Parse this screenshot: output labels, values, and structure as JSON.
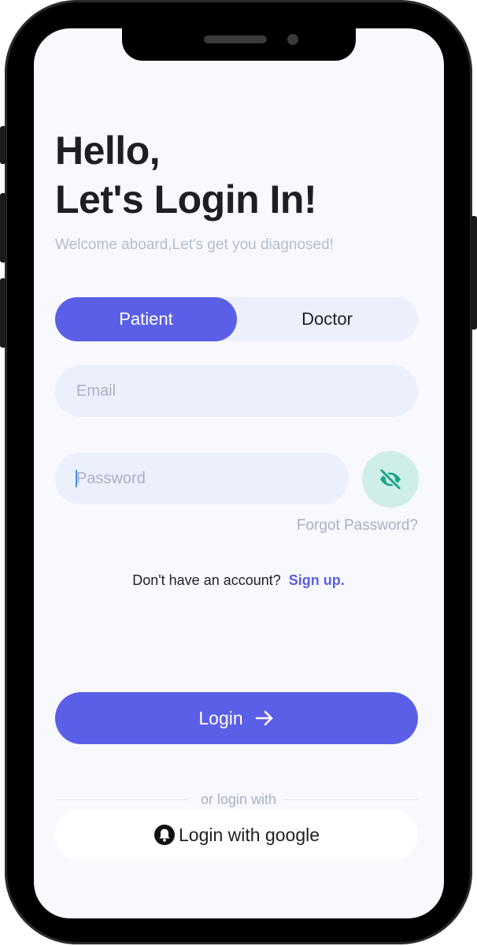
{
  "header": {
    "title_line1": "Hello,",
    "title_line2": "Let's Login In!",
    "subtitle": "Welcome aboard,Let's get you diagnosed!"
  },
  "role_toggle": {
    "selected": "Patient",
    "options": [
      "Patient",
      "Doctor"
    ]
  },
  "form": {
    "email_placeholder": "Email",
    "email_value": "",
    "password_placeholder": "Password",
    "password_value": "",
    "visibility_icon": "eye-off-icon",
    "forgot_password": "Forgot Password?"
  },
  "signup": {
    "prompt": "Don't have an account?",
    "link": "Sign up."
  },
  "login_button": {
    "label": "Login",
    "icon": "arrow-right-icon"
  },
  "alt_login": {
    "divider_text": "or login with",
    "google_label": "Login with google",
    "google_icon": "bell-icon"
  },
  "colors": {
    "accent": "#5b5ee6",
    "background": "#f8f9fe",
    "field_bg": "#ecf0fc",
    "eye_bg": "#cfeee9",
    "eye_icon": "#1aa58c",
    "muted_text": "#a9b0c2"
  }
}
